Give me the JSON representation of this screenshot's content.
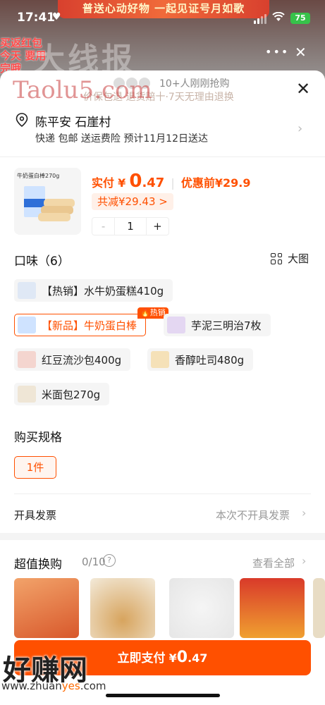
{
  "status": {
    "time": "17:41",
    "battery": "75"
  },
  "background": {
    "banner": "普送心动好物 一起见证号月如歌",
    "left_promo": "买返红包 今天 要用完哦",
    "watermark": "大线报"
  },
  "sheet": {
    "buyers_text": "10+人刚刚抢购",
    "promise_text": "价保包退·退货赔十·7天无理由退换",
    "watermark": "Taolu5.com"
  },
  "address": {
    "name": "陈平安 石崖村",
    "sub": "快递 包邮 送运费险 预计11月12日送达"
  },
  "product": {
    "thumb_label": "牛奶蛋白棒270g",
    "pay_label": "实付",
    "currency": "¥",
    "price_big": "0",
    "price_small": ".47",
    "before_text": "优惠前¥29.9",
    "discount_text": "共减¥29.43 >",
    "minus": "-",
    "quantity": "1",
    "plus": "+"
  },
  "flavor": {
    "title": "口味（6）",
    "view_label": "大图",
    "hot_badge": "热销",
    "options": [
      {
        "label": "【热销】水牛奶蛋糕410g",
        "selected": false
      },
      {
        "label": "【新品】牛奶蛋白棒",
        "selected": true
      },
      {
        "label": "芋泥三明治7枚",
        "selected": false
      },
      {
        "label": "红豆流沙包400g",
        "selected": false
      },
      {
        "label": "香醇吐司480g",
        "selected": false
      },
      {
        "label": "米面包270g",
        "selected": false
      }
    ]
  },
  "spec": {
    "title": "购买规格",
    "option": "1件"
  },
  "invoice": {
    "label": "开具发票",
    "value": "本次不开具发票"
  },
  "deals": {
    "title": "超值换购",
    "count": "0/10",
    "view_all": "查看全部"
  },
  "paybar": {
    "label": "立即支付",
    "currency": "¥",
    "amount_big": "0",
    "amount_small": ".47"
  },
  "watermark_bottom": {
    "text": "好赚网",
    "url_prefix": "www.zhuan",
    "url_mid": "yes",
    "url_suffix": ".com"
  },
  "colors": {
    "accent": "#ff5000",
    "accent_soft": "#fff0e8"
  }
}
